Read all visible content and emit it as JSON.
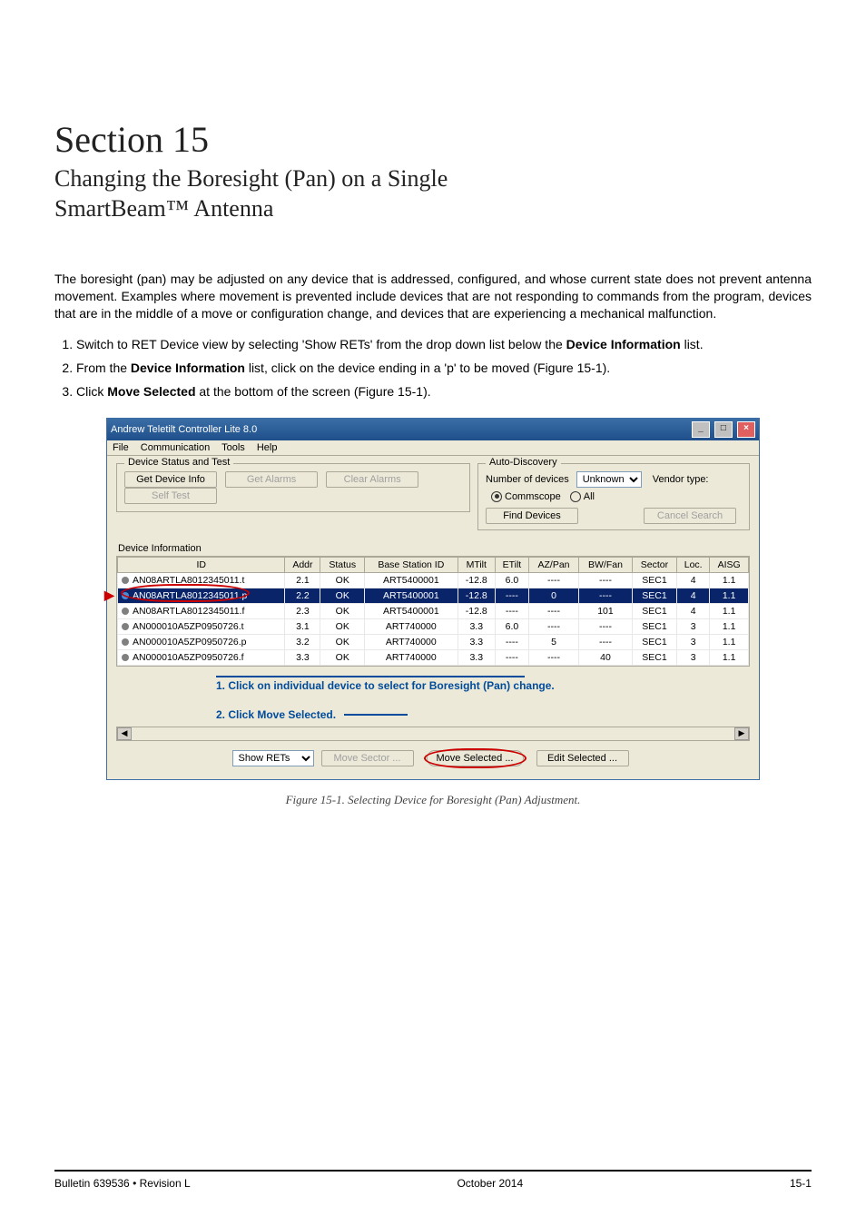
{
  "heading": {
    "section": "Section 15",
    "title_line1": "Changing the Boresight (Pan) on a Single",
    "title_line2": "SmartBeam™ Antenna"
  },
  "intro": "The boresight (pan) may be adjusted on any device that is addressed, configured, and whose current state does not prevent antenna movement. Examples where movement is prevented include devices that are not responding to commands from the program, devices that are in the middle of a move or configuration change, and devices that are experiencing a mechanical malfunction.",
  "steps": [
    {
      "pre": "Switch to RET Device view by selecting 'Show RETs' from the drop down list below the ",
      "bold": "Device Information",
      "post": " list."
    },
    {
      "pre": "From the ",
      "bold": "Device Information",
      "post": " list, click on the device ending in a 'p' to be moved (Figure 15-1)."
    },
    {
      "pre": "Click ",
      "bold": "Move Selected",
      "post": " at the bottom of the screen (Figure 15-1)."
    }
  ],
  "app": {
    "title": "Andrew Teletilt Controller Lite 8.0",
    "menus": [
      "File",
      "Communication",
      "Tools",
      "Help"
    ],
    "group_devstatus": "Device Status and Test",
    "btn_get_info": "Get Device Info",
    "btn_get_alarms": "Get Alarms",
    "btn_clear_alarms": "Clear Alarms",
    "btn_self_test": "Self Test",
    "group_autodisc": "Auto-Discovery",
    "lbl_num_devices": "Number of devices",
    "sel_num_devices": "Unknown",
    "lbl_vendor_type": "Vendor type:",
    "radio_commscope": "Commscope",
    "radio_all": "All",
    "btn_find_devices": "Find Devices",
    "btn_cancel_search": "Cancel Search",
    "lbl_devinfo": "Device Information",
    "columns": [
      "ID",
      "Addr",
      "Status",
      "Base Station ID",
      "MTilt",
      "ETilt",
      "AZ/Pan",
      "BW/Fan",
      "Sector",
      "Loc.",
      "AISG"
    ],
    "rows": [
      {
        "sel": false,
        "bullet": "gray",
        "id": "AN08ARTLA8012345011.t",
        "addr": "2.1",
        "status": "OK",
        "bsid": "ART5400001",
        "mtilt": "-12.8",
        "etilt": "6.0",
        "az": "----",
        "bw": "----",
        "sector": "SEC1",
        "loc": "4",
        "aisg": "1.1"
      },
      {
        "sel": true,
        "bullet": "blue",
        "id": "AN08ARTLA8012345011.p",
        "addr": "2.2",
        "status": "OK",
        "bsid": "ART5400001",
        "mtilt": "-12.8",
        "etilt": "----",
        "az": "0",
        "bw": "----",
        "sector": "SEC1",
        "loc": "4",
        "aisg": "1.1"
      },
      {
        "sel": false,
        "bullet": "gray",
        "id": "AN08ARTLA8012345011.f",
        "addr": "2.3",
        "status": "OK",
        "bsid": "ART5400001",
        "mtilt": "-12.8",
        "etilt": "----",
        "az": "----",
        "bw": "101",
        "sector": "SEC1",
        "loc": "4",
        "aisg": "1.1"
      },
      {
        "sel": false,
        "bullet": "gray",
        "id": "AN000010A5ZP0950726.t",
        "addr": "3.1",
        "status": "OK",
        "bsid": "ART740000",
        "mtilt": "3.3",
        "etilt": "6.0",
        "az": "----",
        "bw": "----",
        "sector": "SEC1",
        "loc": "3",
        "aisg": "1.1"
      },
      {
        "sel": false,
        "bullet": "gray",
        "id": "AN000010A5ZP0950726.p",
        "addr": "3.2",
        "status": "OK",
        "bsid": "ART740000",
        "mtilt": "3.3",
        "etilt": "----",
        "az": "5",
        "bw": "----",
        "sector": "SEC1",
        "loc": "3",
        "aisg": "1.1"
      },
      {
        "sel": false,
        "bullet": "gray",
        "id": "AN000010A5ZP0950726.f",
        "addr": "3.3",
        "status": "OK",
        "bsid": "ART740000",
        "mtilt": "3.3",
        "etilt": "----",
        "az": "----",
        "bw": "40",
        "sector": "SEC1",
        "loc": "3",
        "aisg": "1.1"
      }
    ],
    "callout1": "1. Click on individual device to select for Boresight (Pan) change.",
    "callout2_pre": "2. Click ",
    "callout2_bold": "Move Selected",
    "callout2_post": ".",
    "sel_show": "Show RETs",
    "btn_move_sector": "Move Sector ...",
    "btn_move_selected": "Move Selected ...",
    "btn_edit_selected": "Edit Selected ..."
  },
  "figure_caption": "Figure 15-1. Selecting Device for Boresight (Pan) Adjustment.",
  "footer": {
    "left": "Bulletin 639536  •  Revision L",
    "center": "October 2014",
    "right": "15-1"
  }
}
